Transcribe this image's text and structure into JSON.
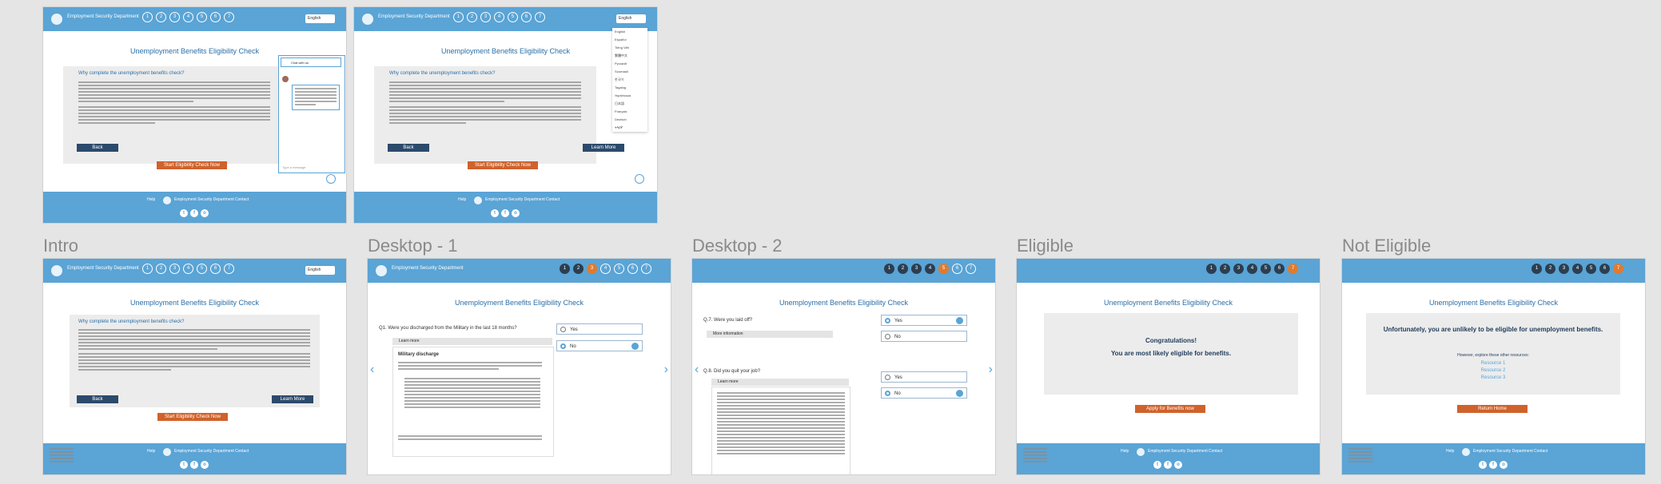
{
  "frame_labels": {
    "intro": "Intro",
    "desktop1": "Desktop - 1",
    "desktop2": "Desktop - 2",
    "eligible": "Eligible",
    "not_eligible": "Not Eligible"
  },
  "colors": {
    "header": "#5aa4d6",
    "accent_orange": "#d0622b",
    "dark_button": "#2c4a6b",
    "title_blue": "#2a6fa8"
  },
  "page": {
    "agency": "Employment Security Department",
    "title": "Unemployment Benefits Eligibility Check",
    "why_heading": "Why complete the unemployment benefits check?",
    "back": "Back",
    "learn_more": "Learn More",
    "start_check": "Start Eligibility Check Now",
    "language": "English",
    "help": "Help",
    "contact": "Contact"
  },
  "chat": {
    "header": "Chat with us",
    "input_placeholder": "Type a message"
  },
  "languages": [
    "English",
    "Español",
    "Tiếng Việt",
    "繁體中文",
    "Русский",
    "Soomaali",
    "한국어",
    "Tagalog",
    "Українська",
    "日本語",
    "Français",
    "Deutsch",
    "ትግርኛ"
  ],
  "desktop1": {
    "q1": "Q1. Were you discharged from the Military in the last 18 months?",
    "acc_open": "Learn more",
    "military": "Military discharge",
    "options": [
      "Yes",
      "No"
    ],
    "selected": "No"
  },
  "desktop2": {
    "q7": "Q.7. Were you laid off?",
    "q7_acc": "More information",
    "q8": "Q.8. Did you quit your job?",
    "q8_acc": "Learn more",
    "options": [
      "Yes",
      "No"
    ],
    "q7_selected": "Yes",
    "q8_selected": "No"
  },
  "eligible": {
    "line1": "Congratulations!",
    "line2": "You are most likely eligible for benefits.",
    "apply": "Apply for Benefits now"
  },
  "not_eligible": {
    "line1": "Unfortunately, you are unlikely to be eligible for unemployment benefits.",
    "line2": "However, explore these other resources:",
    "resources": [
      "Resource 1",
      "Resource 2",
      "Resource 3"
    ],
    "return": "Return Home"
  }
}
